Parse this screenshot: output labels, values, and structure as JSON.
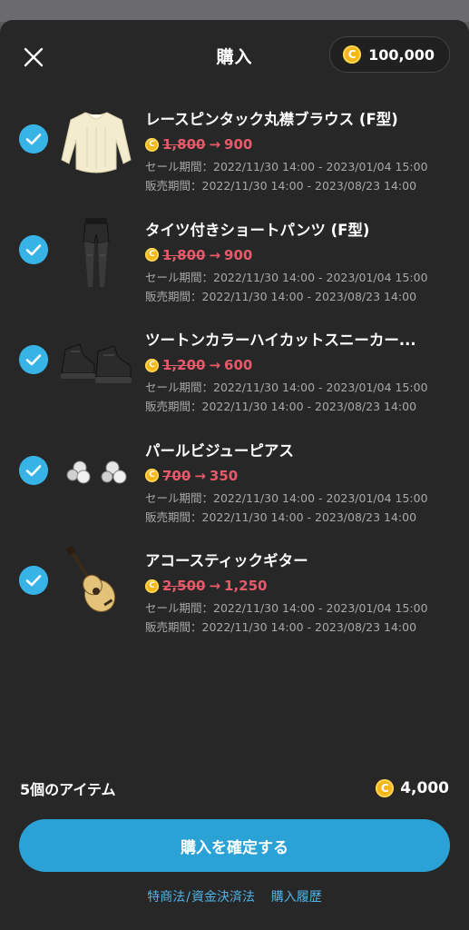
{
  "header": {
    "title": "購入",
    "balance": "100,000"
  },
  "coin_symbol": "C",
  "items": [
    {
      "name": "レースピンタック丸襟ブラウス (F型)",
      "old_price": "1,800",
      "new_price": "900",
      "sale_period": "セール期間：2022/11/30 14:00 - 2023/01/04 15:00",
      "sell_period": "販売期間：2022/11/30 14:00 - 2023/08/23 14:00",
      "icon": "blouse-icon"
    },
    {
      "name": "タイツ付きショートパンツ (F型)",
      "old_price": "1,800",
      "new_price": "900",
      "sale_period": "セール期間：2022/11/30 14:00 - 2023/01/04 15:00",
      "sell_period": "販売期間：2022/11/30 14:00 - 2023/08/23 14:00",
      "icon": "shorts-icon"
    },
    {
      "name": "ツートンカラーハイカットスニーカー...",
      "old_price": "1,200",
      "new_price": "600",
      "sale_period": "セール期間：2022/11/30 14:00 - 2023/01/04 15:00",
      "sell_period": "販売期間：2022/11/30 14:00 - 2023/08/23 14:00",
      "icon": "sneakers-icon"
    },
    {
      "name": "パールビジューピアス",
      "old_price": "700",
      "new_price": "350",
      "sale_period": "セール期間：2022/11/30 14:00 - 2023/01/04 15:00",
      "sell_period": "販売期間：2022/11/30 14:00 - 2023/08/23 14:00",
      "icon": "earrings-icon"
    },
    {
      "name": "アコースティックギター",
      "old_price": "2,500",
      "new_price": "1,250",
      "sale_period": "セール期間：2022/11/30 14:00 - 2023/01/04 15:00",
      "sell_period": "販売期間：2022/11/30 14:00 - 2023/08/23 14:00",
      "icon": "guitar-icon"
    }
  ],
  "arrow": "→",
  "summary": {
    "count_label": "5個のアイテム",
    "total": "4,000"
  },
  "confirm_label": "購入を確定する",
  "links": {
    "legal": "特商法",
    "separator": "/",
    "payment": "資金決済法",
    "history": "購入履歴"
  },
  "colors": {
    "accent": "#2aa2d6",
    "sale": "#e8596a",
    "coin": "#f5b718",
    "background": "#272727"
  }
}
